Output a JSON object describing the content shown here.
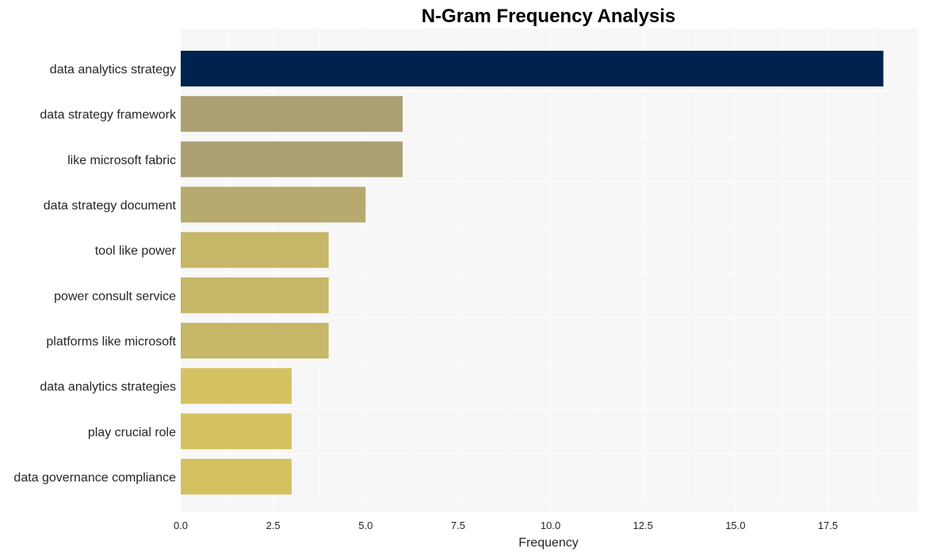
{
  "chart_data": {
    "type": "bar",
    "orientation": "horizontal",
    "title": "N-Gram Frequency Analysis",
    "xlabel": "Frequency",
    "ylabel": "",
    "xlim": [
      0,
      19.9
    ],
    "xticks": [
      0,
      2.5,
      5,
      7.5,
      10,
      12.5,
      15,
      17.5
    ],
    "xtick_labels": [
      "0.0",
      "2.5",
      "5.0",
      "7.5",
      "10.0",
      "12.5",
      "15.0",
      "17.5"
    ],
    "grid": true,
    "categories": [
      "data analytics strategy",
      "data strategy framework",
      "like microsoft fabric",
      "data strategy document",
      "tool like power",
      "power consult service",
      "platforms like microsoft",
      "data analytics strategies",
      "play crucial role",
      "data governance compliance"
    ],
    "values": [
      19,
      6,
      6,
      5,
      4,
      4,
      4,
      3,
      3,
      3
    ],
    "colors": [
      "#00224e",
      "#aba074",
      "#aba074",
      "#b8a96e",
      "#c5b767",
      "#c5b767",
      "#c5b767",
      "#d4c262",
      "#d4c262",
      "#d4c262"
    ],
    "background": "#f7f7f7"
  }
}
